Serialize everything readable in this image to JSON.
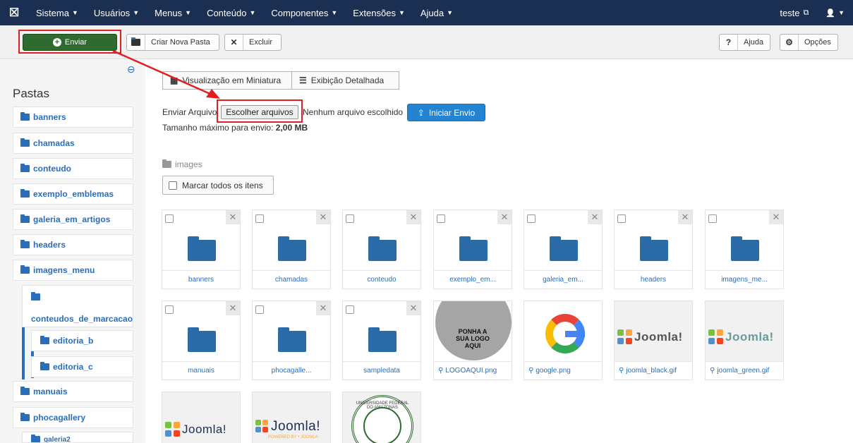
{
  "navbar": {
    "logo_glyph": "☒",
    "menus": [
      {
        "label": "Sistema"
      },
      {
        "label": "Usuários"
      },
      {
        "label": "Menus"
      },
      {
        "label": "Conteúdo"
      },
      {
        "label": "Componentes"
      },
      {
        "label": "Extensões"
      },
      {
        "label": "Ajuda"
      }
    ],
    "site_label": "teste",
    "external_glyph": "⧉",
    "user_glyph": "👤"
  },
  "toolbar": {
    "upload_label": "Enviar",
    "new_folder_label": "Criar Nova Pasta",
    "delete_label": "Excluir",
    "help_label": "Ajuda",
    "options_label": "Opções"
  },
  "sidebar": {
    "title": "Pastas",
    "folders": [
      {
        "label": "banners"
      },
      {
        "label": "chamadas"
      },
      {
        "label": "conteudo"
      },
      {
        "label": "exemplo_emblemas"
      },
      {
        "label": "galeria_em_artigos"
      },
      {
        "label": "headers"
      },
      {
        "label": "imagens_menu"
      },
      {
        "label": "conteudos_de_marcacao"
      },
      {
        "label": "editoria_b"
      },
      {
        "label": "editoria_c"
      },
      {
        "label": "manuais"
      },
      {
        "label": "phocagallery"
      },
      {
        "label": "galeria2"
      }
    ]
  },
  "views": {
    "thumbnail_label": "Visualização em Miniatura",
    "detail_label": "Exibição Detalhada"
  },
  "upload": {
    "label": "Enviar Arquivo",
    "choose_label": "Escolher arquivos",
    "no_file_label": "Nenhum arquivo escolhido",
    "start_label": "Iniciar Envio",
    "max_size_prefix": "Tamanho máximo para envio:",
    "max_size_value": "2,00 MB"
  },
  "browser": {
    "path": "images",
    "check_all_label": "Marcar todos os itens",
    "folders": [
      {
        "label": "banners"
      },
      {
        "label": "chamadas"
      },
      {
        "label": "conteudo"
      },
      {
        "label": "exemplo_em..."
      },
      {
        "label": "galeria_em..."
      },
      {
        "label": "headers"
      },
      {
        "label": "imagens_me..."
      },
      {
        "label": "manuais"
      },
      {
        "label": "phocagalle..."
      },
      {
        "label": "sampledata"
      }
    ],
    "images": [
      {
        "label": "LOGOAQUI.png",
        "text_l1": "PONHA A",
        "text_l2": "SUA LOGO",
        "text_l3": "AQUI"
      },
      {
        "label": "google.png"
      },
      {
        "label": "joomla_black.gif",
        "word": "Joomla!"
      },
      {
        "label": "joomla_green.gif",
        "word": "Joomla!"
      },
      {
        "word": "Joomla!"
      },
      {
        "word": "Joomla!",
        "sub": "POWERED BY • JOOMLA"
      },
      {
        "seal_text": "UNIVERSIDADE FEDERAL DO AMAZONAS"
      }
    ]
  },
  "colors": {
    "navbar_bg": "#1a2f52",
    "upload_green": "#2f6a2f",
    "link_blue": "#2a6ebb",
    "primary_blue": "#2384d3",
    "annotation_red": "#e02020"
  }
}
